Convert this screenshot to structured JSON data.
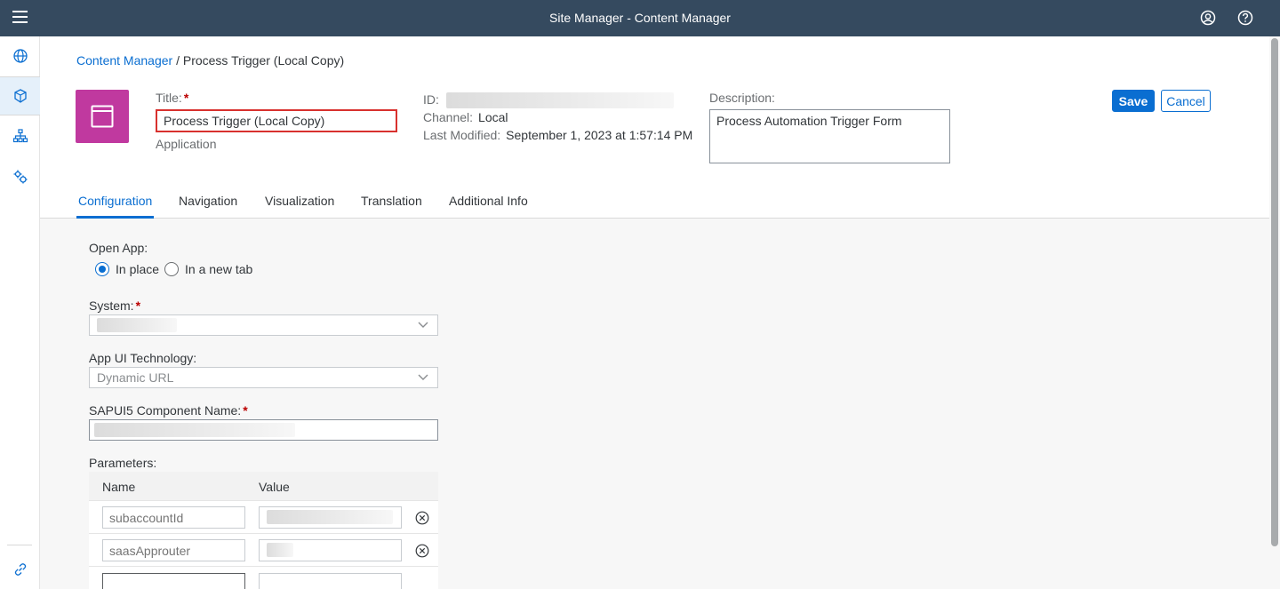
{
  "shell": {
    "title": "Site Manager - Content Manager",
    "icons": [
      "menu-icon",
      "user-icon",
      "help-icon"
    ]
  },
  "sidebar": {
    "items": [
      {
        "name": "globe-icon",
        "active": false
      },
      {
        "name": "content-package-icon",
        "active": true
      },
      {
        "name": "hierarchy-icon",
        "active": false
      },
      {
        "name": "settings-icon",
        "active": false
      }
    ],
    "footer_icon": "link-icon"
  },
  "breadcrumb": {
    "parent": "Content Manager",
    "separator": "/",
    "current": "Process Trigger (Local Copy)"
  },
  "header": {
    "tile_icon": "application-window-icon",
    "tile_color": "#c0399f",
    "title_label": "Title:",
    "required_mark": "*",
    "title_value": "Process Trigger (Local Copy)",
    "type": "Application",
    "id_label": "ID:",
    "channel_label": "Channel:",
    "channel_value": "Local",
    "last_modified_label": "Last Modified:",
    "last_modified_value": "September 1, 2023 at 1:57:14 PM",
    "description_label": "Description:",
    "description_value": "Process Automation Trigger Form",
    "save_label": "Save",
    "cancel_label": "Cancel"
  },
  "tabs": [
    {
      "label": "Configuration",
      "active": true
    },
    {
      "label": "Navigation",
      "active": false
    },
    {
      "label": "Visualization",
      "active": false
    },
    {
      "label": "Translation",
      "active": false
    },
    {
      "label": "Additional Info",
      "active": false
    }
  ],
  "form": {
    "open_app_label": "Open App:",
    "open_app_options": [
      {
        "label": "In place",
        "selected": true
      },
      {
        "label": "In a new tab",
        "selected": false
      }
    ],
    "system_label": "System:",
    "app_ui_tech_label": "App UI Technology:",
    "app_ui_tech_value": "Dynamic URL",
    "component_label": "SAPUI5 Component Name:",
    "parameters_label": "Parameters:",
    "param_headers": {
      "name": "Name",
      "value": "Value"
    },
    "params": [
      {
        "name": "subaccountId"
      },
      {
        "name": "saasApprouter"
      }
    ]
  },
  "colors": {
    "shell": "#354a5f",
    "accent": "#0a6ed1",
    "required": "#bb0000",
    "highlight_border": "#d8312e"
  }
}
